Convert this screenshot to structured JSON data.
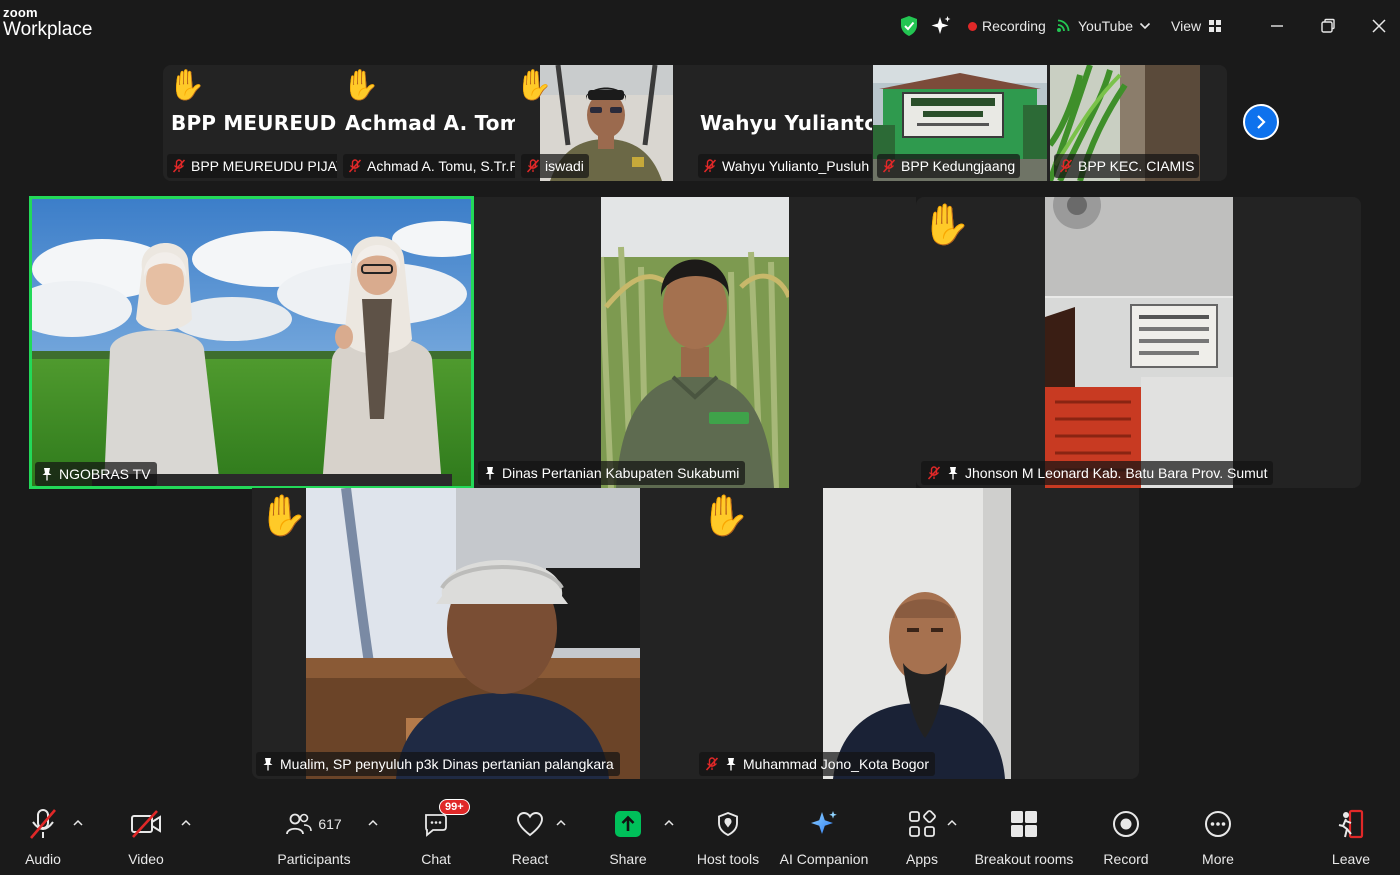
{
  "app": {
    "brand_top": "zoom",
    "brand_bottom": "Workplace"
  },
  "titlebar": {
    "recording_label": "Recording",
    "youtube_label": "YouTube",
    "view_label": "View"
  },
  "strip": {
    "tiles": [
      {
        "name": "BPP MEUREUD...",
        "label": "BPP MEUREUDU PIJAY"
      },
      {
        "name": "Achmad A. Tom...",
        "label": "Achmad A. Tomu, S.Tr.P"
      },
      {
        "name": "",
        "label": "iswadi"
      },
      {
        "name": "Wahyu Yulianto...",
        "label": "Wahyu Yulianto_Pusluh"
      },
      {
        "name": "",
        "label": "BPP Kedungjaang"
      },
      {
        "name": "",
        "label": "BPP KEC. CIAMIS"
      }
    ]
  },
  "gallery": {
    "tiles": [
      {
        "label": "NGOBRAS TV"
      },
      {
        "label": "Dinas Pertanian Kabupaten Sukabumi"
      },
      {
        "label": "Jhonson M Leonard Kab. Batu Bara Prov. Sumut"
      },
      {
        "label": "Mualim, SP penyuluh p3k Dinas pertanian palangkara"
      },
      {
        "label": "Muhammad Jono_Kota Bogor"
      }
    ]
  },
  "toolbar": {
    "audio": "Audio",
    "video": "Video",
    "participants": "Participants",
    "participants_count": "617",
    "chat": "Chat",
    "chat_badge": "99+",
    "react": "React",
    "share": "Share",
    "host_tools": "Host tools",
    "ai_companion": "AI Companion",
    "apps": "Apps",
    "breakout_rooms": "Breakout rooms",
    "record": "Record",
    "more": "More",
    "leave": "Leave"
  },
  "colors": {
    "accent": "#0e72ed",
    "active_speaker": "#23d959",
    "share_green": "#00c05a",
    "muted_red": "#e02828"
  }
}
